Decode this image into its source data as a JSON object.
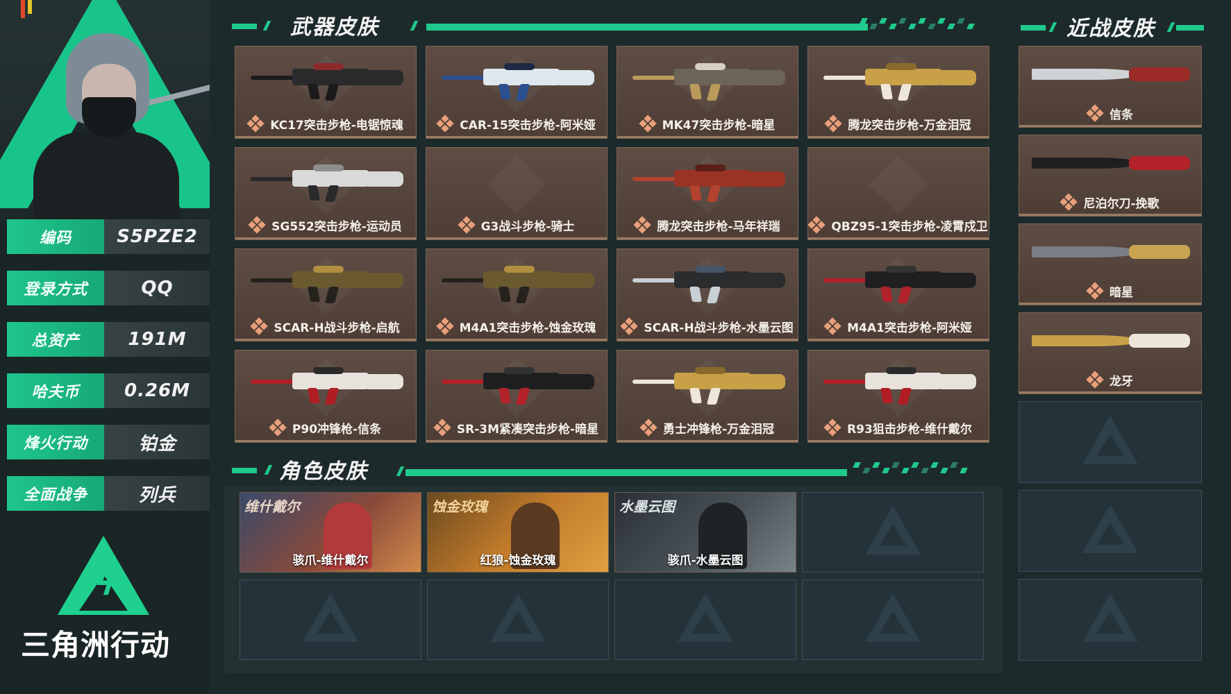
{
  "profile": {
    "stats": [
      {
        "label": "编码",
        "value": "S5PZE2"
      },
      {
        "label": "登录方式",
        "value": "QQ"
      },
      {
        "label": "总资产",
        "value": "191M"
      },
      {
        "label": "哈夫币",
        "value": "0.26M"
      },
      {
        "label": "烽火行动",
        "value": "铂金"
      },
      {
        "label": "全面战争",
        "value": "列兵"
      }
    ],
    "logo_text": "三角洲行动"
  },
  "sections": {
    "weapons_title": "武器皮肤",
    "melee_title": "近战皮肤",
    "characters_title": "角色皮肤"
  },
  "weapons": [
    {
      "name": "KC17突击步枪-电锯惊魂",
      "palette": "dark-red"
    },
    {
      "name": "CAR-15突击步枪-阿米娅",
      "palette": "blue-white"
    },
    {
      "name": "MK47突击步枪-暗星",
      "palette": "gold-grey"
    },
    {
      "name": "腾龙突击步枪-万金泪冠",
      "palette": "gold-white"
    },
    {
      "name": "SG552突击步枪-运动员",
      "palette": "white-black"
    },
    {
      "name": "G3战斗步枪-骑士",
      "palette": "none"
    },
    {
      "name": "腾龙突击步枪-马年祥瑞",
      "palette": "red"
    },
    {
      "name": "QBZ95-1突击步枪-凌霄戍卫",
      "palette": "none"
    },
    {
      "name": "SCAR-H战斗步枪-启航",
      "palette": "gold-black"
    },
    {
      "name": "M4A1突击步枪-蚀金玫瑰",
      "palette": "gold-black"
    },
    {
      "name": "SCAR-H战斗步枪-水墨云图",
      "palette": "black-white"
    },
    {
      "name": "M4A1突击步枪-阿米娅",
      "palette": "red-black"
    },
    {
      "name": "P90冲锋枪-信条",
      "palette": "red-white"
    },
    {
      "name": "SR-3M紧凑突击步枪-暗星",
      "palette": "red-black"
    },
    {
      "name": "勇士冲锋枪-万金泪冠",
      "palette": "gold-white"
    },
    {
      "name": "R93狙击步枪-维什戴尔",
      "palette": "red-white"
    }
  ],
  "melee": [
    {
      "name": "信条",
      "palette": "silver-red"
    },
    {
      "name": "尼泊尔刀-挽歌",
      "palette": "red-black"
    },
    {
      "name": "暗星",
      "palette": "grey-gold"
    },
    {
      "name": "龙牙",
      "palette": "gold-white"
    }
  ],
  "melee_empty_slots": 3,
  "characters": [
    {
      "title": "维什戴尔",
      "name": "骇爪-维什戴尔",
      "palette": "sunset"
    },
    {
      "title": "蚀金玫瑰",
      "name": "红狼-蚀金玫瑰",
      "palette": "fire"
    },
    {
      "title": "水墨云图",
      "name": "骇爪-水墨云图",
      "palette": "ink"
    }
  ],
  "character_empty_slots": 5,
  "colors": {
    "accent": "#20c98c",
    "card_bg": "#57463e",
    "empty_bg": "#24333a",
    "page_bg": "#1d2a2b"
  },
  "icons": [
    "rarity-diamond-icon",
    "delta-force-logo-icon"
  ]
}
